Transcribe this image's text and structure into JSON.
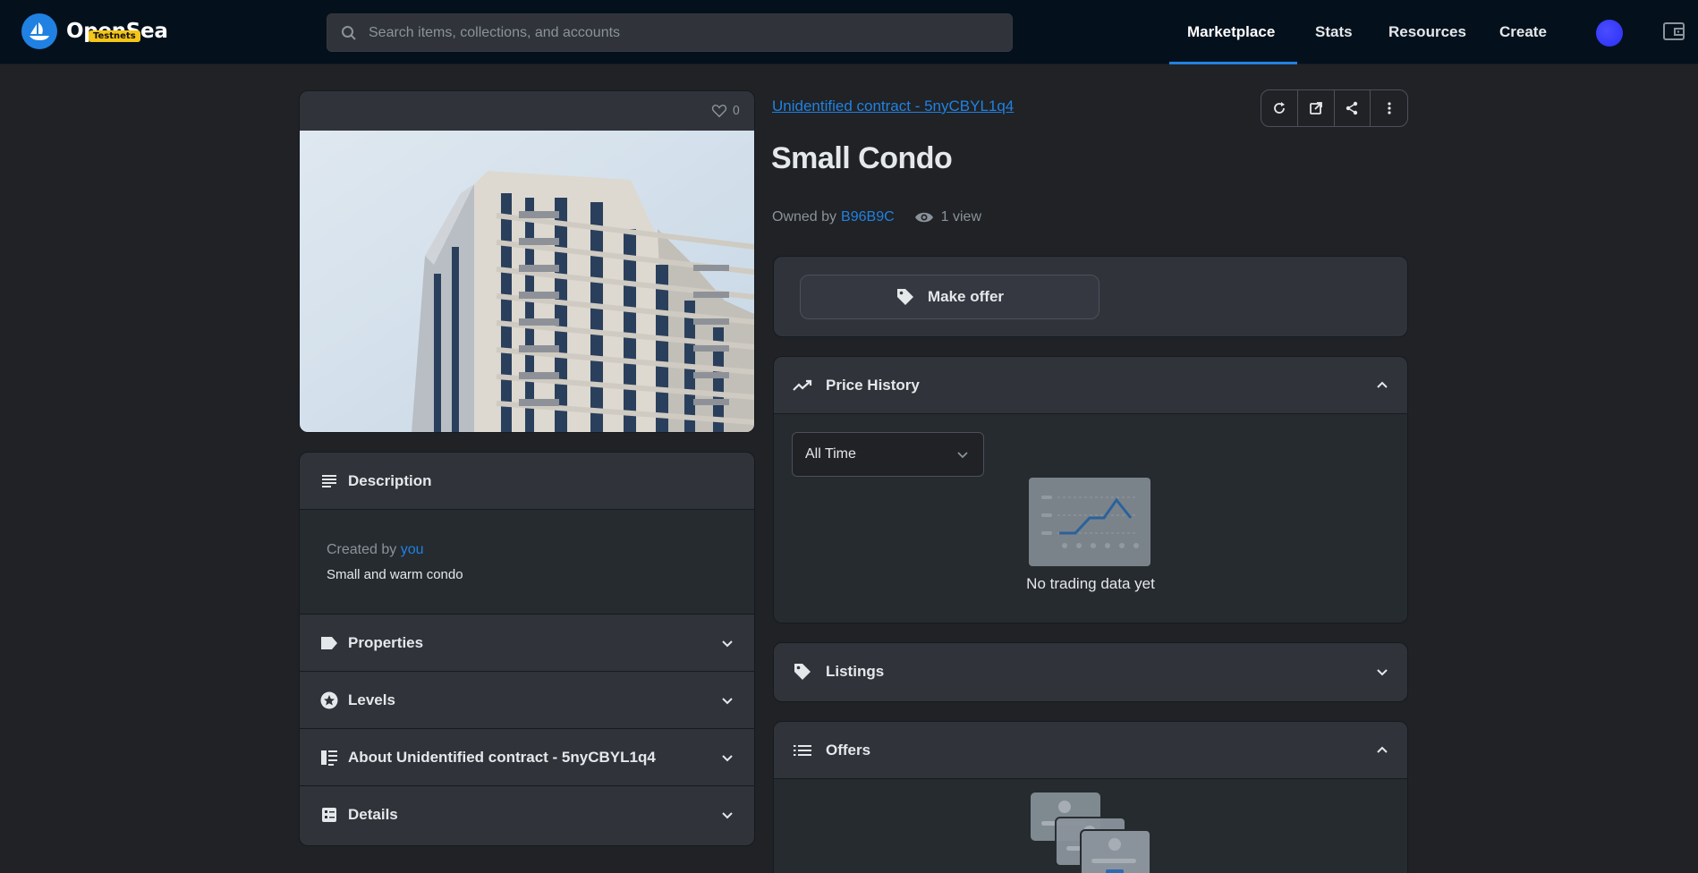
{
  "header": {
    "logo_text": "OpenSea",
    "badge": "Testnets",
    "search_placeholder": "Search items, collections, and accounts",
    "nav": [
      "Marketplace",
      "Stats",
      "Resources",
      "Create"
    ],
    "active_nav": "Marketplace"
  },
  "item": {
    "favorites": "0",
    "contract": "Unidentified contract - 5nyCBYL1q4",
    "title": "Small Condo",
    "owned_by_label": "Owned by",
    "owner": "B96B9C",
    "views": "1 view"
  },
  "left_panels": {
    "description": {
      "title": "Description",
      "created_by_label": "Created by",
      "created_by": "you",
      "text": "Small and warm condo"
    },
    "properties": "Properties",
    "levels": "Levels",
    "about": "About Unidentified contract - 5nyCBYL1q4",
    "details": "Details"
  },
  "actions": {
    "make_offer": "Make offer"
  },
  "price_history": {
    "title": "Price History",
    "range": "All Time",
    "empty": "No trading data yet"
  },
  "listings": {
    "title": "Listings"
  },
  "offers": {
    "title": "Offers"
  },
  "colors": {
    "accent": "#2081e2",
    "header_bg": "#04111d",
    "page_bg": "#202225",
    "panel_bg": "#303339",
    "badge": "#f5c518"
  }
}
